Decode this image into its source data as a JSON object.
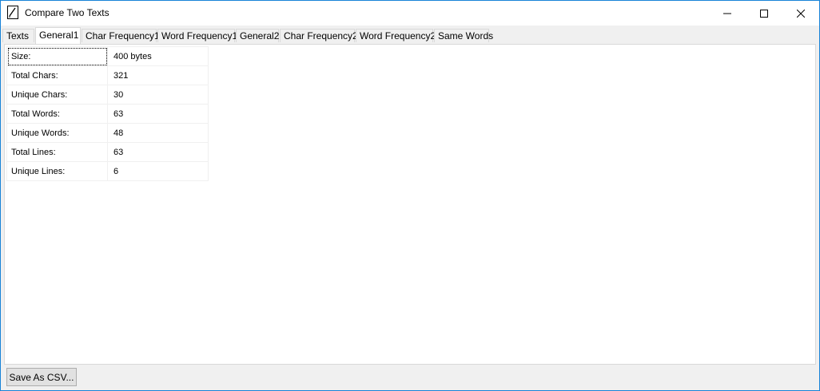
{
  "window": {
    "title": "Compare Two Texts",
    "icon": "notepad-pen-icon",
    "controls": {
      "minimize": "minimize-icon",
      "maximize": "maximize-icon",
      "close": "close-icon"
    }
  },
  "tabs": [
    {
      "label": "Texts",
      "active": false
    },
    {
      "label": "General1",
      "active": true
    },
    {
      "label": "Char Frequency1",
      "active": false
    },
    {
      "label": "Word Frequency1",
      "active": false
    },
    {
      "label": "General2",
      "active": false
    },
    {
      "label": "Char Frequency2",
      "active": false
    },
    {
      "label": "Word Frequency2",
      "active": false
    },
    {
      "label": "Same Words",
      "active": false
    }
  ],
  "stats": [
    {
      "label": "Size:",
      "value": "400 bytes"
    },
    {
      "label": "Total Chars:",
      "value": "321"
    },
    {
      "label": "Unique Chars:",
      "value": "30"
    },
    {
      "label": "Total Words:",
      "value": "63"
    },
    {
      "label": "Unique Words:",
      "value": "48"
    },
    {
      "label": "Total Lines:",
      "value": "63"
    },
    {
      "label": "Unique Lines:",
      "value": "6"
    }
  ],
  "footer": {
    "save_csv_label": "Save As CSV..."
  },
  "colors": {
    "accent_border": "#1883d7",
    "chrome": "#f0f0f0",
    "panel": "#ffffff"
  }
}
